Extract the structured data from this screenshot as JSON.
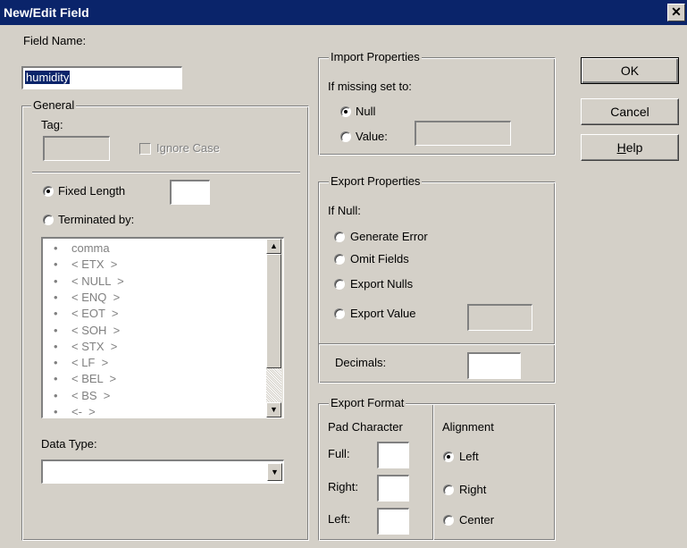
{
  "window": {
    "title": "New/Edit Field",
    "close_glyph": "✕"
  },
  "field_name": {
    "label": "Field Name:",
    "value": "humidity"
  },
  "general": {
    "legend": "General",
    "tag_label": "Tag:",
    "tag_value": "",
    "ignore_case_label": "Ignore Case",
    "fixed_length_label": "Fixed Length",
    "fixed_length_value": "",
    "terminated_by_label": "Terminated by:",
    "terminators": [
      "comma",
      "< ETX  >",
      "< NULL  >",
      "< ENQ  >",
      "< EOT  >",
      "< SOH  >",
      "< STX  >",
      "< LF  >",
      "< BEL  >",
      "< BS  >",
      "<-  >"
    ],
    "bullet": "•",
    "data_type_label": "Data Type:",
    "data_type_value": ""
  },
  "import": {
    "legend": "Import Properties",
    "subtitle": "If missing set to:",
    "null_label": "Null",
    "value_label": "Value:",
    "value_value": ""
  },
  "export": {
    "legend": "Export Properties",
    "subtitle": "If Null:",
    "options": [
      "Generate Error",
      "Omit Fields",
      "Export Nulls",
      "Export Value"
    ],
    "export_value_value": "",
    "decimals_label": "Decimals:",
    "decimals_value": ""
  },
  "export_format": {
    "legend": "Export Format",
    "pad_title": "Pad Character",
    "full_label": "Full:",
    "right_label": "Right:",
    "left_label": "Left:",
    "alignment_title": "Alignment",
    "align_left": "Left",
    "align_right": "Right",
    "align_center": "Center"
  },
  "buttons": {
    "ok": "OK",
    "cancel": "Cancel",
    "help_prefix": "",
    "help_underlined": "H",
    "help_rest": "elp"
  },
  "icons": {
    "scroll_up": "▲",
    "scroll_down": "▼",
    "dropdown": "▼"
  }
}
